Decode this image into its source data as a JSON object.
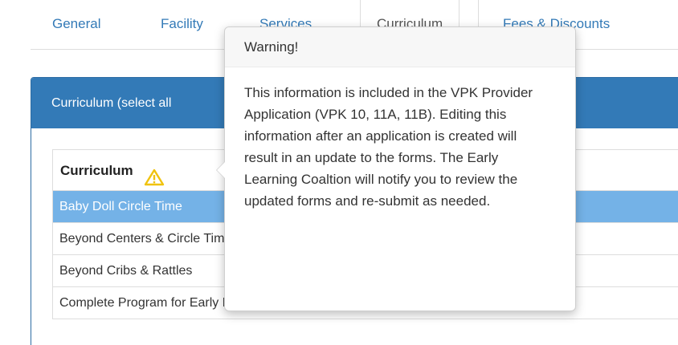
{
  "tabs": [
    {
      "label": "General"
    },
    {
      "label": "Facility"
    },
    {
      "label": "Services"
    },
    {
      "label": "Curriculum"
    },
    {
      "label": "Fees & Discounts"
    }
  ],
  "active_tab": "Curriculum",
  "panel": {
    "heading": "Curriculum (select all"
  },
  "table": {
    "header": "Curriculum",
    "header_icon": "warning-icon",
    "rows": [
      {
        "label": "Baby Doll Circle Time",
        "selected": true
      },
      {
        "label": "Beyond Centers & Circle Time",
        "selected": false
      },
      {
        "label": "Beyond Cribs & Rattles",
        "selected": false
      },
      {
        "label": "Complete Program for Early Literacy Success - Level Two",
        "selected": false
      }
    ]
  },
  "popover": {
    "title": "Warning!",
    "content": "This information is included in the VPK Provider Application (VPK 10, 11A, 11B). Editing this information after an application is created will result in an update to the forms. The Early Learning Coaltion will notify you to review the updated forms and re-submit as needed."
  },
  "colors": {
    "primary": "#337ab7",
    "selected_row": "#74b2e7",
    "warning": "#f0c30f"
  }
}
